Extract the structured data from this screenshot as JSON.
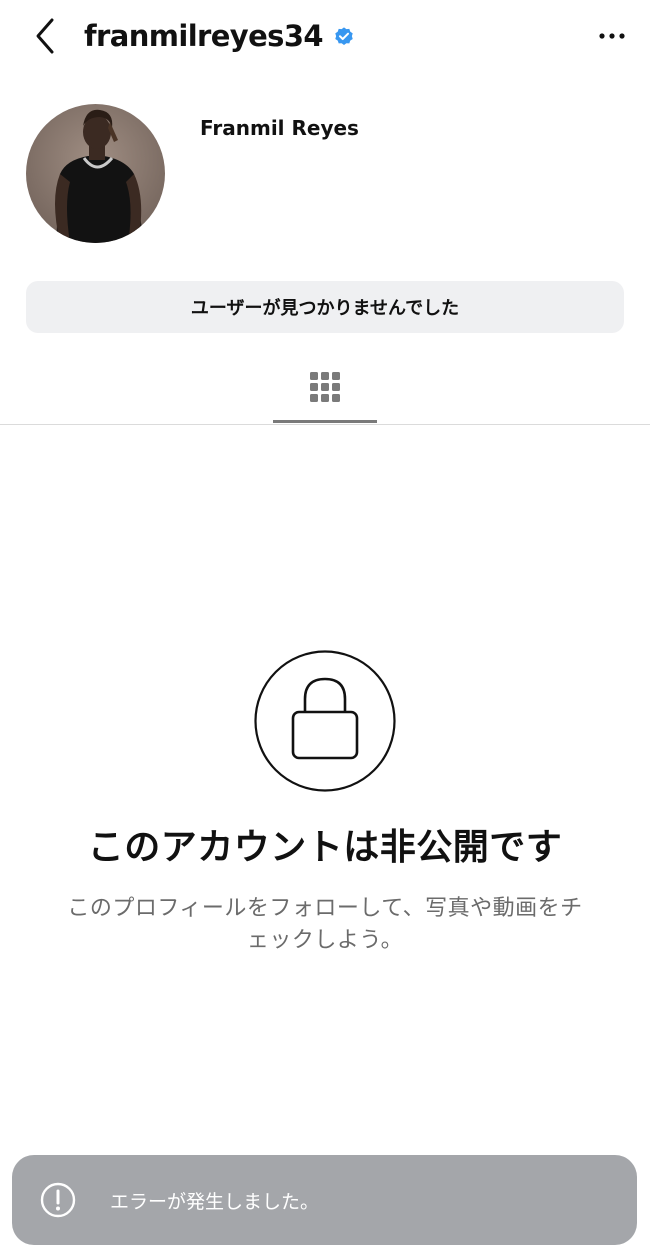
{
  "header": {
    "username": "franmilreyes34",
    "verified_color": "#3897f0",
    "back_icon": "chevron-left-icon",
    "more_icon": "ellipsis-icon"
  },
  "profile": {
    "display_name": "Franmil Reyes",
    "avatar_description_colors": [
      "#8c7a6e",
      "#111111"
    ],
    "status_button_label": "ユーザーが見つかりませんでした"
  },
  "tabs": [
    {
      "name": "grid",
      "icon": "grid-icon",
      "active": true
    }
  ],
  "private_notice": {
    "icon": "lock-icon",
    "title": "このアカウントは非公開です",
    "description_line1": "このプロフィールをフォローして、写真や動画をチ",
    "description_line2": "ェックしよう。"
  },
  "toast": {
    "icon": "exclamation-circle-icon",
    "message": "エラーが発生しました。",
    "background": "#a4a6aa"
  }
}
